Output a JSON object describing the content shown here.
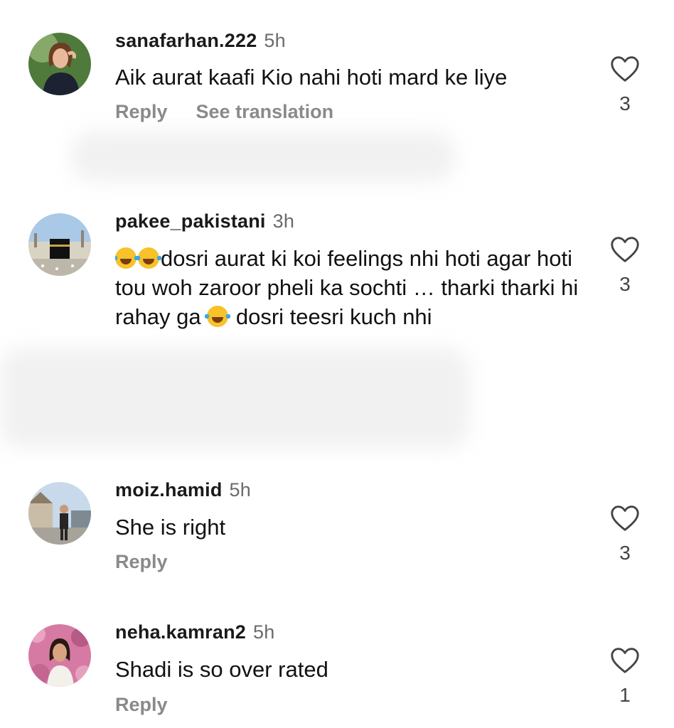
{
  "comments": [
    {
      "username": "sanafarhan.222",
      "time": "5h",
      "text": "Aik aurat kaafi Kio nahi hoti mard ke liye",
      "reply_label": "Reply",
      "translate_label": "See translation",
      "likes": "3"
    },
    {
      "username": "pakee_pakistani",
      "time": "3h",
      "text_part1": "dosri aurat ki koi feelings nhi hoti agar hoti tou woh zaroor pheli ka sochti … tharki tharki hi rahay ga ",
      "text_part2": " dosri teesri kuch nhi",
      "emoji": "face-with-tears-of-joy",
      "likes": "3"
    },
    {
      "username": "moiz.hamid",
      "time": "5h",
      "text": "She is right",
      "reply_label": "Reply",
      "likes": "3"
    },
    {
      "username": "neha.kamran2",
      "time": "5h",
      "text": "Shadi is so over rated",
      "reply_label": "Reply",
      "likes": "1"
    }
  ],
  "icons": {
    "like": "heart-outline-icon"
  },
  "colors": {
    "username": "#1a1a1a",
    "secondary": "#8a8a8a",
    "text": "#111111"
  }
}
